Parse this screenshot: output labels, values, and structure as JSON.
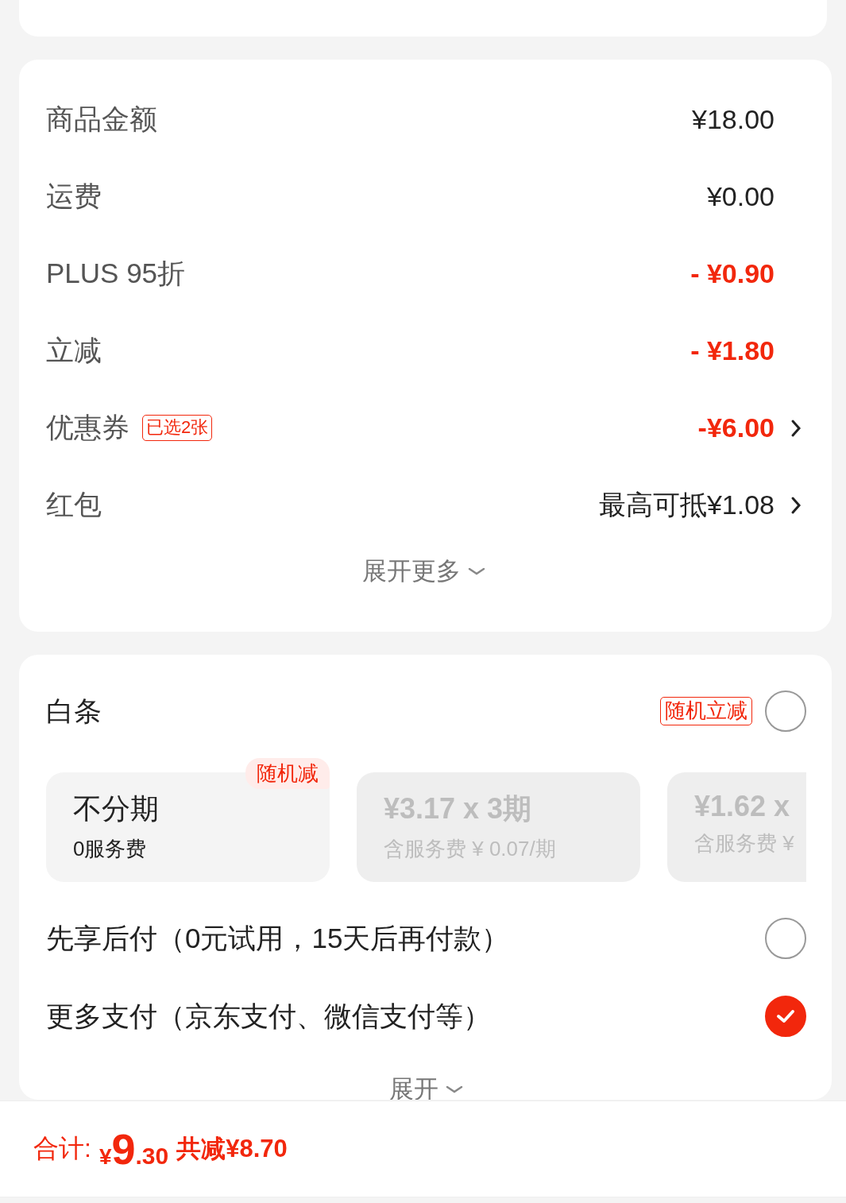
{
  "summary": {
    "rows": [
      {
        "label": "商品金额",
        "value": "¥18.00",
        "kind": "normal",
        "link": false
      },
      {
        "label": "运费",
        "value": "¥0.00",
        "kind": "normal",
        "link": false
      },
      {
        "label": "PLUS 95折",
        "value": "- ¥0.90",
        "kind": "discount",
        "link": false
      },
      {
        "label": "立减",
        "value": "- ¥1.80",
        "kind": "discount",
        "link": false
      },
      {
        "label": "优惠券",
        "badge": "已选2张",
        "value": "-¥6.00",
        "kind": "discount",
        "link": true
      },
      {
        "label": "红包",
        "value": "最高可抵¥1.08",
        "kind": "normal",
        "link": true
      }
    ],
    "expand": "展开更多"
  },
  "payment": {
    "methods": [
      {
        "label": "白条",
        "badge": "随机立减",
        "checked": false,
        "installments": [
          {
            "title": "不分期",
            "subtitle": "0服务费",
            "disabled": false,
            "badge": "随机减"
          },
          {
            "title": "¥3.17 x 3期",
            "subtitle": "含服务费 ¥ 0.07/期",
            "disabled": true
          },
          {
            "title": "¥1.62 x",
            "subtitle": "含服务费 ¥",
            "disabled": true
          }
        ]
      },
      {
        "label": "先享后付（0元试用，15天后再付款）",
        "checked": false
      },
      {
        "label": "更多支付（京东支付、微信支付等）",
        "checked": true
      }
    ],
    "expand": "展开"
  },
  "footer": {
    "total_label": "合计:",
    "currency": "¥",
    "total_integer": "9",
    "total_decimal": ".30",
    "saving": "共减¥8.70"
  }
}
